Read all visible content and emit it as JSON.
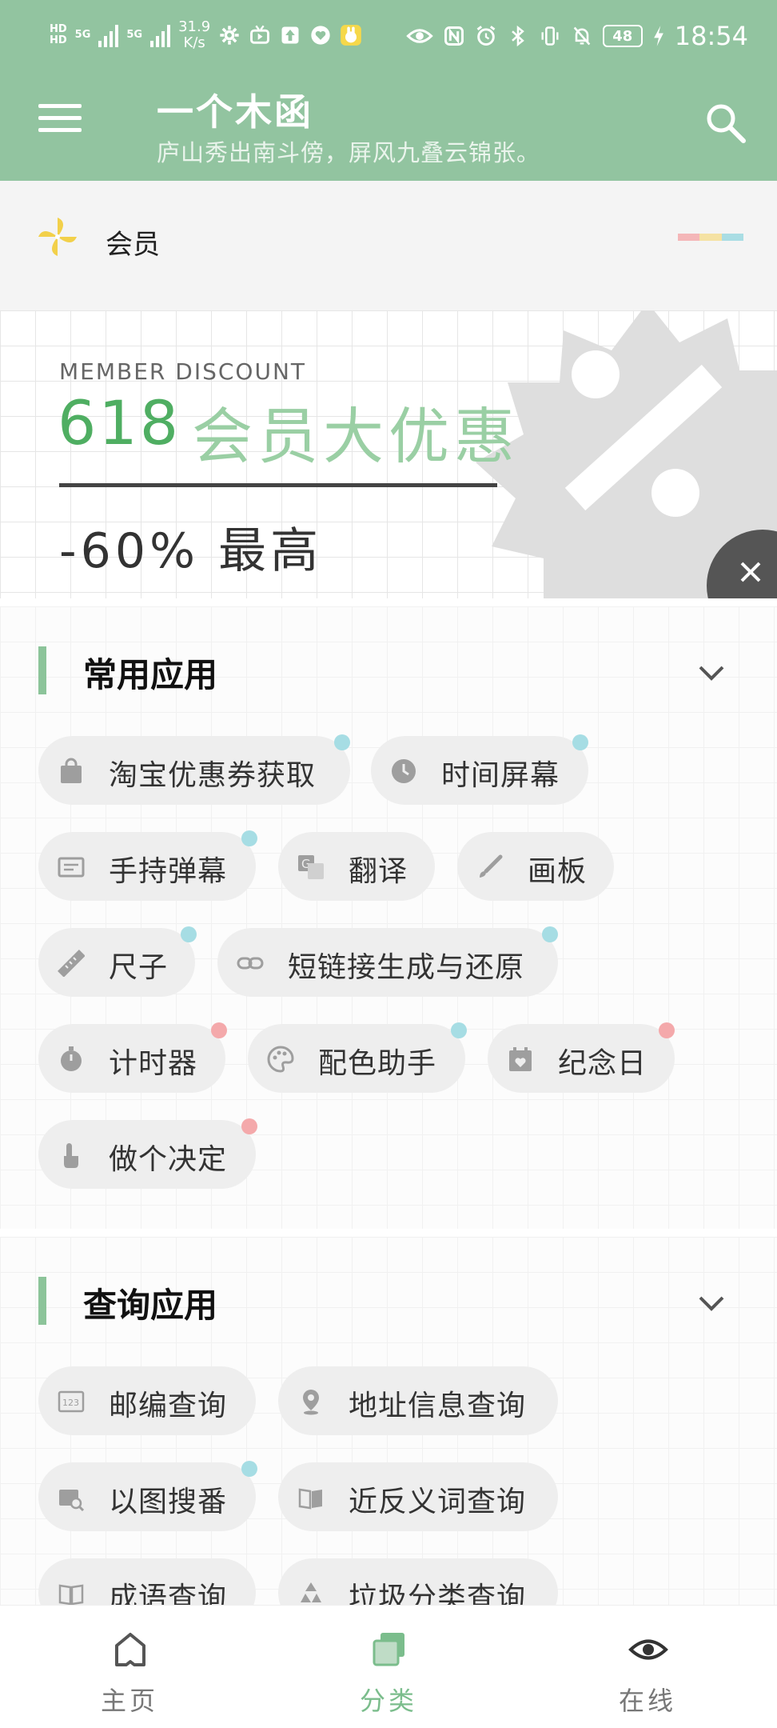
{
  "status_bar": {
    "network_left_1": "HD",
    "network_left_2": "HD",
    "gen_1": "5G",
    "gen_2": "5G",
    "speed_value": "31.9",
    "speed_unit": "K/s",
    "battery": "48",
    "time": "18:54"
  },
  "header": {
    "title": "一个木函",
    "subtitle": "庐山秀出南斗傍，屏风九叠云锦张。"
  },
  "member": {
    "label": "会员",
    "stripe_colors": [
      "#f4b6b8",
      "#f5e2a3",
      "#a9dde4"
    ]
  },
  "banner": {
    "en_label": "MEMBER DISCOUNT",
    "number": "618",
    "headline": "会员大优惠",
    "discount": "-60% 最高"
  },
  "sections": [
    {
      "title": "常用应用",
      "items": [
        {
          "label": "淘宝优惠券获取",
          "icon": "shopping-bag-icon",
          "badge": "blue"
        },
        {
          "label": "时间屏幕",
          "icon": "clock-icon",
          "badge": "blue"
        },
        {
          "label": "手持弹幕",
          "icon": "danmaku-screen-icon",
          "badge": "blue"
        },
        {
          "label": "翻译",
          "icon": "translate-icon",
          "badge": ""
        },
        {
          "label": "画板",
          "icon": "brush-icon",
          "badge": ""
        },
        {
          "label": "尺子",
          "icon": "ruler-icon",
          "badge": "blue"
        },
        {
          "label": "短链接生成与还原",
          "icon": "link-icon",
          "badge": "blue"
        },
        {
          "label": "计时器",
          "icon": "stopwatch-icon",
          "badge": "pink"
        },
        {
          "label": "配色助手",
          "icon": "palette-icon",
          "badge": "blue"
        },
        {
          "label": "纪念日",
          "icon": "calendar-heart-icon",
          "badge": "pink"
        },
        {
          "label": "做个决定",
          "icon": "tap-hand-icon",
          "badge": "pink"
        }
      ]
    },
    {
      "title": "查询应用",
      "items": [
        {
          "label": "邮编查询",
          "icon": "postcode-123-icon",
          "badge": ""
        },
        {
          "label": "地址信息查询",
          "icon": "location-pin-icon",
          "badge": ""
        },
        {
          "label": "以图搜番",
          "icon": "image-search-icon",
          "badge": "blue"
        },
        {
          "label": "近反义词查询",
          "icon": "open-book-icon",
          "badge": ""
        },
        {
          "label": "成语查询",
          "icon": "book-icon",
          "badge": ""
        },
        {
          "label": "垃圾分类查询",
          "icon": "recycle-icon",
          "badge": ""
        }
      ]
    }
  ],
  "bottom_nav": [
    {
      "label": "主页",
      "icon": "home-icon",
      "active": false
    },
    {
      "label": "分类",
      "icon": "category-icon",
      "active": true
    },
    {
      "label": "在线",
      "icon": "eye-icon",
      "active": false
    }
  ],
  "colors": {
    "header_green": "#92c4a0",
    "accent_green": "#8cc49a",
    "badge_blue": "#a6dde4",
    "badge_pink": "#f4a9ab"
  }
}
